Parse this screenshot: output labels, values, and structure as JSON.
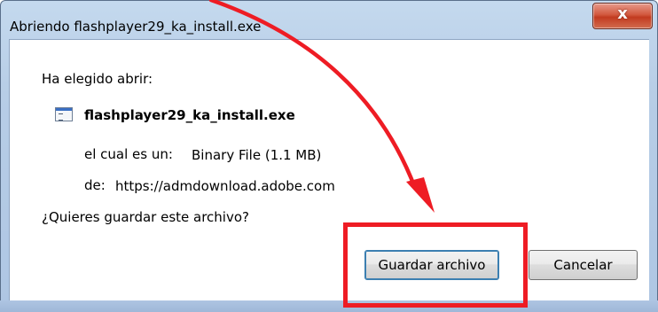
{
  "dialog": {
    "title": "Abriendo flashplayer29_ka_install.exe",
    "close_label": "x",
    "intro": "Ha elegido abrir:",
    "file_name": "flashplayer29_ka_install.exe",
    "type_label": "el cual es un:",
    "type_value": "Binary File (1.1 MB)",
    "from_label": "de:",
    "from_value": "https://admdownload.adobe.com",
    "question": "¿Quieres guardar este archivo?",
    "save_button": "Guardar archivo",
    "cancel_button": "Cancelar"
  },
  "annotation": {
    "color": "#ee1c24",
    "icon": "red-arrow-icon"
  }
}
